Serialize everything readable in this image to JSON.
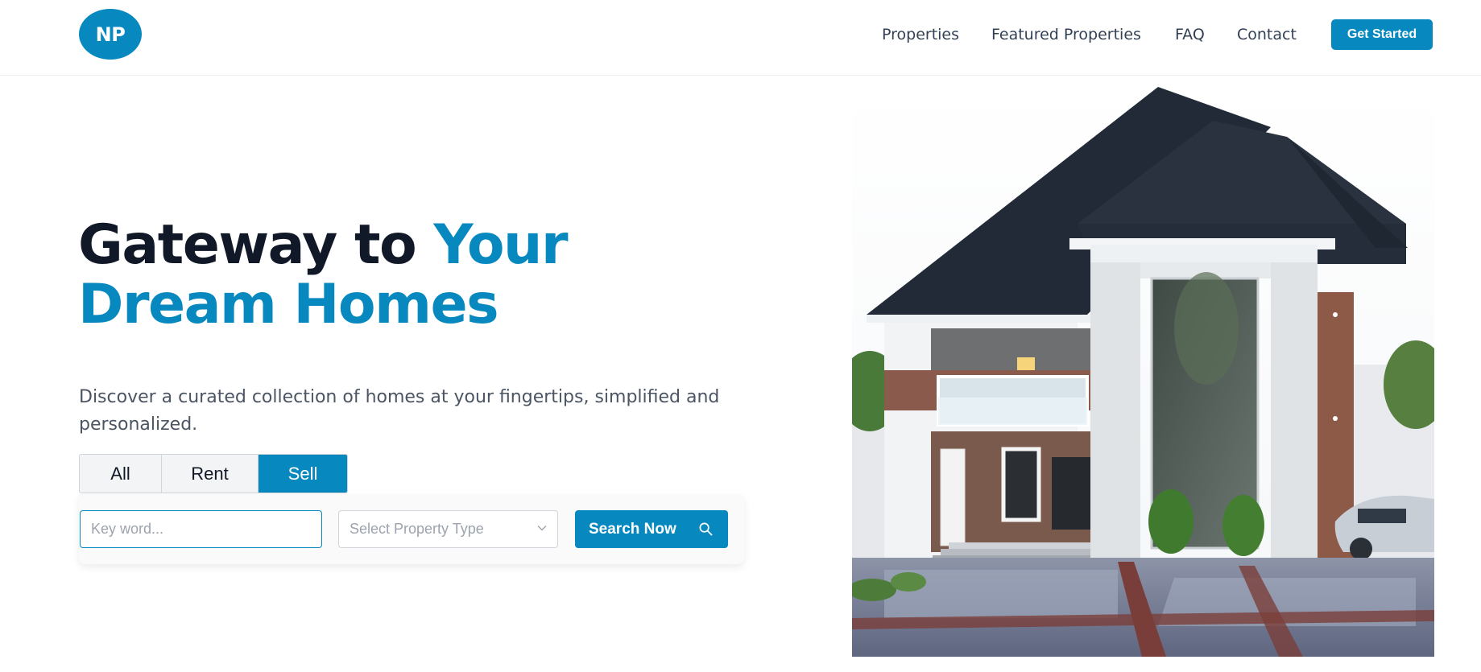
{
  "header": {
    "logo_text": "NP",
    "nav": [
      {
        "label": "Properties"
      },
      {
        "label": "Featured Properties"
      },
      {
        "label": "FAQ"
      },
      {
        "label": "Contact"
      }
    ],
    "cta_label": "Get Started"
  },
  "hero": {
    "headline_part1": "Gateway to ",
    "headline_part2": "Your",
    "headline_part3": "Dream Homes",
    "subtitle": "Discover a curated collection of homes at your fingertips, simplified and personalized."
  },
  "search": {
    "tabs": [
      {
        "label": "All",
        "active": false
      },
      {
        "label": "Rent",
        "active": false
      },
      {
        "label": "Sell",
        "active": true
      }
    ],
    "keyword_placeholder": "Key word...",
    "keyword_value": "",
    "type_placeholder": "Select Property Type",
    "button_label": "Search Now",
    "button_icon": "search-icon"
  },
  "colors": {
    "accent": "#0789c0",
    "heading": "#111827",
    "body_text": "#4b5563"
  }
}
